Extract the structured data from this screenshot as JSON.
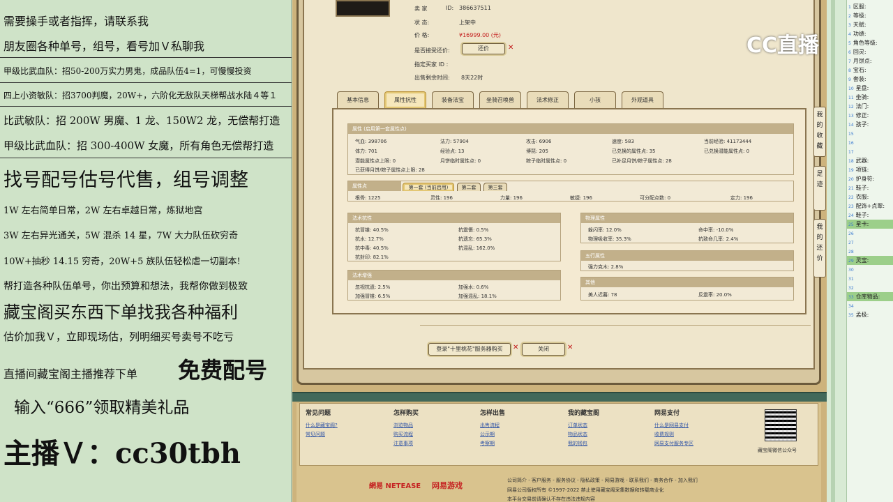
{
  "ads": {
    "line1": "需要操手或者指挥，请联系我",
    "line2": "朋友圈各种单号，组号，看号加Ｖ私聊我",
    "line3": "甲级比武血队：招50-200万实力男鬼，成品队伍4=1，可慢慢投资",
    "line4": "四上小资敏队：招3700判魔，20W+，六阶化无敌队天梯帮战水陆４等１",
    "line5": "比武敏队：招 200W 男魔、1 龙、150W2 龙，无偿帮打造",
    "line6": "甲级比武血队：招 300-400W 女魔，所有角色无偿帮打造",
    "line7": "找号配号估号代售，组号调整",
    "line8": "1W 左右简单日常，2W 左右卓越日常，炼狱地宫",
    "line9": "3W 左右异光通关，5W 混杀 14 星，7W 大力队伍砍穷奇",
    "line10": "10W+抽秒 14.15 穷奇，20W+5 族队伍轻松虐一切副本!",
    "line11": "帮打造各种队伍单号，你出预算和想法，我帮你做到极致",
    "line12": "藏宝阁买东西下单找我各种福利",
    "line13": "估价加我Ｖ，立即现场估，列明细买号卖号不吃亏",
    "line14a": "直播间藏宝阁主播推荐下单",
    "line14b": "免费配号",
    "line15": "输入“666”领取精美礼品",
    "line16": "主播Ｖ：cc30tbh"
  },
  "info": {
    "seller_label": "卖  家",
    "seller_id_label": "ID:",
    "seller_id": "386637511",
    "status_label": "状      态:",
    "status": "上架中",
    "price_label": "价      格:",
    "price": "¥16999.00 (元)",
    "bargain_label": "是否接受还价:",
    "bargain_btn": "还价",
    "buyer_label": "指定买家 ID :",
    "remaining_label": "出售剩余时间:",
    "remaining": "8天22时"
  },
  "tabs": [
    "基本信息",
    "属性抗性",
    "装备法宝",
    "坐骑召唤兽",
    "法术修正",
    "小孩",
    "外观道具"
  ],
  "attrs": {
    "header": "属性 (启用第一套属性点)",
    "qixue": "气血: 398706",
    "fali": "法力: 57904",
    "gongji": "攻击: 6906",
    "sudu": "速度: 583",
    "exp": "当前经验: 41173444",
    "tili": "体力: 701",
    "jingyan": "经验点: 13",
    "tianshi": "博琵: 205",
    "exchanged": "已兑换的属性点: 35",
    "exch_latent": "已兑换潜能属性点: 0",
    "latent_cap": "潜能属性点上限: 0",
    "month_temp": "月饼临时属性点: 0",
    "zongzi_temp": "粽子临时属性点: 0",
    "filled": "已补足月饼/粽子属性点: 28",
    "acquired": "已获得月饼/粽子属性点上限: 28"
  },
  "points": {
    "header": "属性点",
    "sets": [
      "第一套 (当前启用)",
      "第二套",
      "第三套"
    ],
    "genggu": "根骨: 1225",
    "lingxing": "灵性: 196",
    "liliang": "力量: 196",
    "minjie": "敏捷: 196",
    "kefen": "可分配点数: 0",
    "dingli": "定力: 196"
  },
  "fashu": {
    "header": "法术抗性",
    "a1": "抗冒锥: 40.5%",
    "b1": "抗震慑: 0.5%",
    "a2": "抗水: 12.7%",
    "b2": "抗遗忘: 65.3%",
    "a3": "抗中毒: 40.5%",
    "b3": "抗混乱: 162.0%",
    "a4": "抗封印: 82.1%"
  },
  "zengqiang": {
    "header": "法术增强",
    "a1": "忽视抗遗: 2.5%",
    "b1": "加强水: 0.6%",
    "a2": "加强冒锥: 6.5%",
    "b2": "加强混乱: 18.1%"
  },
  "wuli": {
    "header": "物理属性",
    "a1": "躲闪率: 12.0%",
    "b1": "命中率: -10.0%",
    "a2": "物理吸收率: 35.3%",
    "b2": "抗致命几率: 2.4%"
  },
  "wuxing": {
    "header": "五行属性",
    "a1": "强力克木: 2.8%"
  },
  "other": {
    "header": "其他",
    "a1": "美人迟暮: 78",
    "b1": "反震率: 20.0%"
  },
  "buttons": {
    "buy": "登录\"十里桃花\"服务器购买",
    "close": "关闭"
  },
  "side_buttons": {
    "collect": "我的收藏",
    "footprint": "足迹",
    "bargain": "我的还价"
  },
  "footer": {
    "cols": [
      {
        "title": "常见问题",
        "links": [
          "什么是藏宝阁?",
          "常见问题"
        ]
      },
      {
        "title": "怎样购买",
        "links": [
          "浏览物品",
          "购买流程",
          "注意事项"
        ]
      },
      {
        "title": "怎样出售",
        "links": [
          "出售流程",
          "公示期",
          "考察期"
        ]
      },
      {
        "title": "我的藏宝阁",
        "links": [
          "订单状态",
          "物品状态",
          "我的钱包"
        ]
      },
      {
        "title": "网易支付",
        "links": [
          "什么是网易支付",
          "收费规则",
          "网易支付服务专区"
        ]
      }
    ],
    "qr_caption": "藏宝阁微信公众号",
    "netease": "網易 NETEASE",
    "game": "网易游戏",
    "links_line": "公司简介 - 客户服务 - 服务协议 - 隐私政策 - 网易游戏 - 联系我们 - 商务合作 - 加入我们",
    "copyright": "网易公司版权所有 ©1997-2022 禁止使用藏宝阁采集数据和转载商业化",
    "notice": "本平台交易前请确认不存在违法违规内容"
  },
  "right_list": [
    {
      "label": "区服:",
      "hl": false
    },
    {
      "label": "等级:",
      "hl": false
    },
    {
      "label": "天赋:",
      "hl": false
    },
    {
      "label": "功绩:",
      "hl": false
    },
    {
      "label": "角色等级:",
      "hl": false
    },
    {
      "label": "回灵:",
      "hl": false
    },
    {
      "label": "月饼点:",
      "hl": false
    },
    {
      "label": "宝石:",
      "hl": false
    },
    {
      "label": "套装:",
      "hl": false
    },
    {
      "label": "星盘:",
      "hl": false
    },
    {
      "label": "坐骑:",
      "hl": false
    },
    {
      "label": "法门:",
      "hl": false
    },
    {
      "label": "修正:",
      "hl": false
    },
    {
      "label": "孩子:",
      "hl": false
    },
    {
      "label": "",
      "hl": false
    },
    {
      "label": "",
      "hl": false
    },
    {
      "label": "",
      "hl": false
    },
    {
      "label": "武器:",
      "hl": false
    },
    {
      "label": "项链:",
      "hl": false
    },
    {
      "label": "护身符:",
      "hl": false
    },
    {
      "label": "鞋子:",
      "hl": false
    },
    {
      "label": "衣服:",
      "hl": false
    },
    {
      "label": "配饰+点翠:",
      "hl": false
    },
    {
      "label": "鞋子:",
      "hl": false
    },
    {
      "label": "星卡:",
      "hl": true
    },
    {
      "label": "",
      "hl": false
    },
    {
      "label": "",
      "hl": false
    },
    {
      "label": "",
      "hl": false
    },
    {
      "label": "灵宝:",
      "hl": true
    },
    {
      "label": "",
      "hl": false
    },
    {
      "label": "",
      "hl": false
    },
    {
      "label": "",
      "hl": false
    },
    {
      "label": "仓库物品:",
      "hl": true
    },
    {
      "label": "",
      "hl": false
    },
    {
      "label": "孟极:",
      "hl": false
    }
  ],
  "watermark": "CC直播"
}
